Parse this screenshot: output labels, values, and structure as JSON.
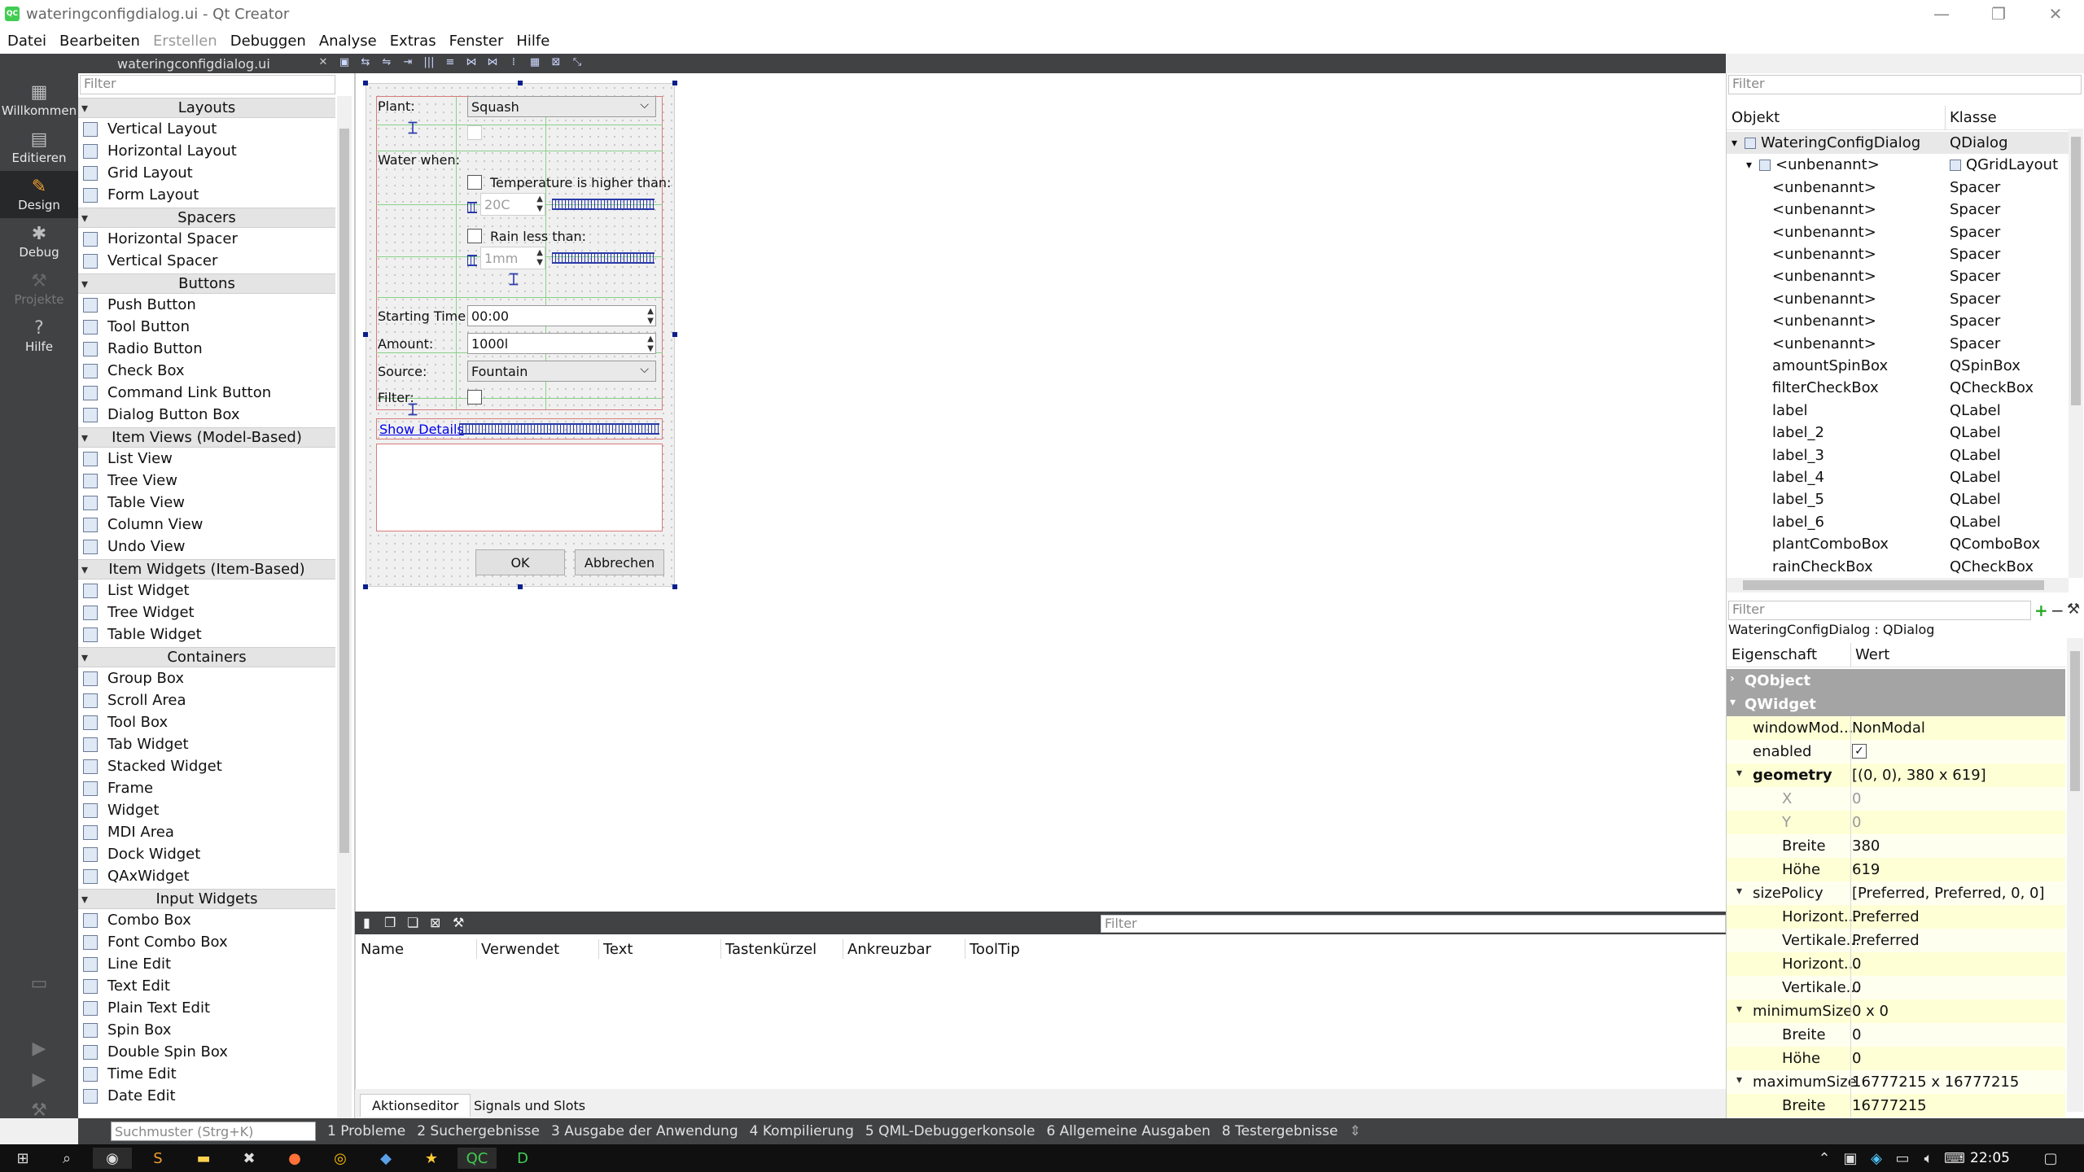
{
  "window": {
    "title": "wateringconfigdialog.ui - Qt Creator"
  },
  "menu": [
    "Datei",
    "Bearbeiten",
    "Erstellen",
    "Debuggen",
    "Analyse",
    "Extras",
    "Fenster",
    "Hilfe"
  ],
  "modes": [
    {
      "label": "Willkommen",
      "icon": "grid-icon"
    },
    {
      "label": "Editieren",
      "icon": "document-icon"
    },
    {
      "label": "Design",
      "icon": "pen-icon"
    },
    {
      "label": "Debug",
      "icon": "bug-icon"
    },
    {
      "label": "Projekte",
      "icon": "wrench-icon"
    },
    {
      "label": "Hilfe",
      "icon": "help-icon"
    }
  ],
  "editor": {
    "document": "wateringconfigdialog.ui"
  },
  "widgetbox": {
    "filter_placeholder": "Filter",
    "categories": [
      {
        "name": "Layouts",
        "items": [
          "Vertical Layout",
          "Horizontal Layout",
          "Grid Layout",
          "Form Layout"
        ]
      },
      {
        "name": "Spacers",
        "items": [
          "Horizontal Spacer",
          "Vertical Spacer"
        ]
      },
      {
        "name": "Buttons",
        "items": [
          "Push Button",
          "Tool Button",
          "Radio Button",
          "Check Box",
          "Command Link Button",
          "Dialog Button Box"
        ]
      },
      {
        "name": "Item Views (Model-Based)",
        "items": [
          "List View",
          "Tree View",
          "Table View",
          "Column View",
          "Undo View"
        ]
      },
      {
        "name": "Item Widgets (Item-Based)",
        "items": [
          "List Widget",
          "Tree Widget",
          "Table Widget"
        ]
      },
      {
        "name": "Containers",
        "items": [
          "Group Box",
          "Scroll Area",
          "Tool Box",
          "Tab Widget",
          "Stacked Widget",
          "Frame",
          "Widget",
          "MDI Area",
          "Dock Widget",
          "QAxWidget"
        ]
      },
      {
        "name": "Input Widgets",
        "items": [
          "Combo Box",
          "Font Combo Box",
          "Line Edit",
          "Text Edit",
          "Plain Text Edit",
          "Spin Box",
          "Double Spin Box",
          "Time Edit",
          "Date Edit"
        ]
      }
    ]
  },
  "form": {
    "plant_label": "Plant:",
    "plant_value": "Squash",
    "water_when_label": "Water when:",
    "temp_check_label": "Temperature is higher than:",
    "temp_value": "20C",
    "rain_check_label": "Rain less than:",
    "rain_value": "1mm",
    "start_label": "Starting Time:",
    "start_value": "00:00",
    "amount_label": "Amount:",
    "amount_value": "1000l",
    "source_label": "Source:",
    "source_value": "Fountain",
    "filter_label": "Filter:",
    "details_link": "Show Details",
    "ok": "OK",
    "cancel": "Abbrechen"
  },
  "action_editor": {
    "filter_placeholder": "Filter",
    "columns": [
      "Name",
      "Verwendet",
      "Text",
      "Tastenkürzel",
      "Ankreuzbar",
      "ToolTip"
    ],
    "tabs": [
      "Aktionseditor",
      "Signals und Slots"
    ]
  },
  "object_inspector": {
    "filter_placeholder": "Filter",
    "columns": [
      "Objekt",
      "Klasse"
    ],
    "rows": [
      {
        "object": "WateringConfigDialog",
        "class": "QDialog",
        "level": 0,
        "expander": "▾",
        "selected": true
      },
      {
        "object": "<unbenannt>",
        "class": "QGridLayout",
        "level": 1,
        "expander": "▾"
      },
      {
        "object": "<unbenannt>",
        "class": "Spacer",
        "level": 2
      },
      {
        "object": "<unbenannt>",
        "class": "Spacer",
        "level": 2
      },
      {
        "object": "<unbenannt>",
        "class": "Spacer",
        "level": 2
      },
      {
        "object": "<unbenannt>",
        "class": "Spacer",
        "level": 2
      },
      {
        "object": "<unbenannt>",
        "class": "Spacer",
        "level": 2
      },
      {
        "object": "<unbenannt>",
        "class": "Spacer",
        "level": 2
      },
      {
        "object": "<unbenannt>",
        "class": "Spacer",
        "level": 2
      },
      {
        "object": "<unbenannt>",
        "class": "Spacer",
        "level": 2
      },
      {
        "object": "amountSpinBox",
        "class": "QSpinBox",
        "level": 2
      },
      {
        "object": "filterCheckBox",
        "class": "QCheckBox",
        "level": 2
      },
      {
        "object": "label",
        "class": "QLabel",
        "level": 2
      },
      {
        "object": "label_2",
        "class": "QLabel",
        "level": 2
      },
      {
        "object": "label_3",
        "class": "QLabel",
        "level": 2
      },
      {
        "object": "label_4",
        "class": "QLabel",
        "level": 2
      },
      {
        "object": "label_5",
        "class": "QLabel",
        "level": 2
      },
      {
        "object": "label_6",
        "class": "QLabel",
        "level": 2
      },
      {
        "object": "plantComboBox",
        "class": "QComboBox",
        "level": 2
      },
      {
        "object": "rainCheckBox",
        "class": "QCheckBox",
        "level": 2
      }
    ]
  },
  "property_editor": {
    "filter_placeholder": "Filter",
    "context": "WateringConfigDialog : QDialog",
    "columns": [
      "Eigenschaft",
      "Wert"
    ],
    "rows": [
      {
        "name": "QObject",
        "value": "",
        "kind": "group",
        "expander": "›"
      },
      {
        "name": "QWidget",
        "value": "",
        "kind": "group",
        "expander": "▾"
      },
      {
        "name": "windowMod...",
        "value": "NonModal",
        "kind": "y",
        "level": 1
      },
      {
        "name": "enabled",
        "value": "✓",
        "kind": "y2",
        "level": 1
      },
      {
        "name": "geometry",
        "value": "[(0, 0), 380 x 619]",
        "kind": "y",
        "level": 1,
        "bold": true,
        "expander": "▾"
      },
      {
        "name": "X",
        "value": "0",
        "kind": "y2",
        "level": 2,
        "dim": true
      },
      {
        "name": "Y",
        "value": "0",
        "kind": "y",
        "level": 2,
        "dim": true
      },
      {
        "name": "Breite",
        "value": "380",
        "kind": "y2",
        "level": 2
      },
      {
        "name": "Höhe",
        "value": "619",
        "kind": "y",
        "level": 2
      },
      {
        "name": "sizePolicy",
        "value": "[Preferred, Preferred, 0, 0]",
        "kind": "y2",
        "level": 1,
        "expander": "▾"
      },
      {
        "name": "Horizont...",
        "value": "Preferred",
        "kind": "y",
        "level": 2
      },
      {
        "name": "Vertikale...",
        "value": "Preferred",
        "kind": "y2",
        "level": 2
      },
      {
        "name": "Horizont...",
        "value": "0",
        "kind": "y",
        "level": 2
      },
      {
        "name": "Vertikale...",
        "value": "0",
        "kind": "y2",
        "level": 2
      },
      {
        "name": "minimumSize",
        "value": "0 x 0",
        "kind": "y",
        "level": 1,
        "expander": "▾"
      },
      {
        "name": "Breite",
        "value": "0",
        "kind": "y2",
        "level": 2
      },
      {
        "name": "Höhe",
        "value": "0",
        "kind": "y",
        "level": 2
      },
      {
        "name": "maximumSize",
        "value": "16777215 x 16777215",
        "kind": "y2",
        "level": 1,
        "expander": "▾"
      },
      {
        "name": "Breite",
        "value": "16777215",
        "kind": "y",
        "level": 2
      }
    ]
  },
  "output_panes": {
    "search_placeholder": "Suchmuster (Strg+K)",
    "panes": [
      "1 Probleme",
      "2 Suchergebnisse",
      "3 Ausgabe der Anwendung",
      "4 Kompilierung",
      "5 QML-Debuggerkonsole",
      "6 Allgemeine Ausgaben",
      "8 Testergebnisse"
    ]
  },
  "taskbar": {
    "clock": "22:05"
  }
}
